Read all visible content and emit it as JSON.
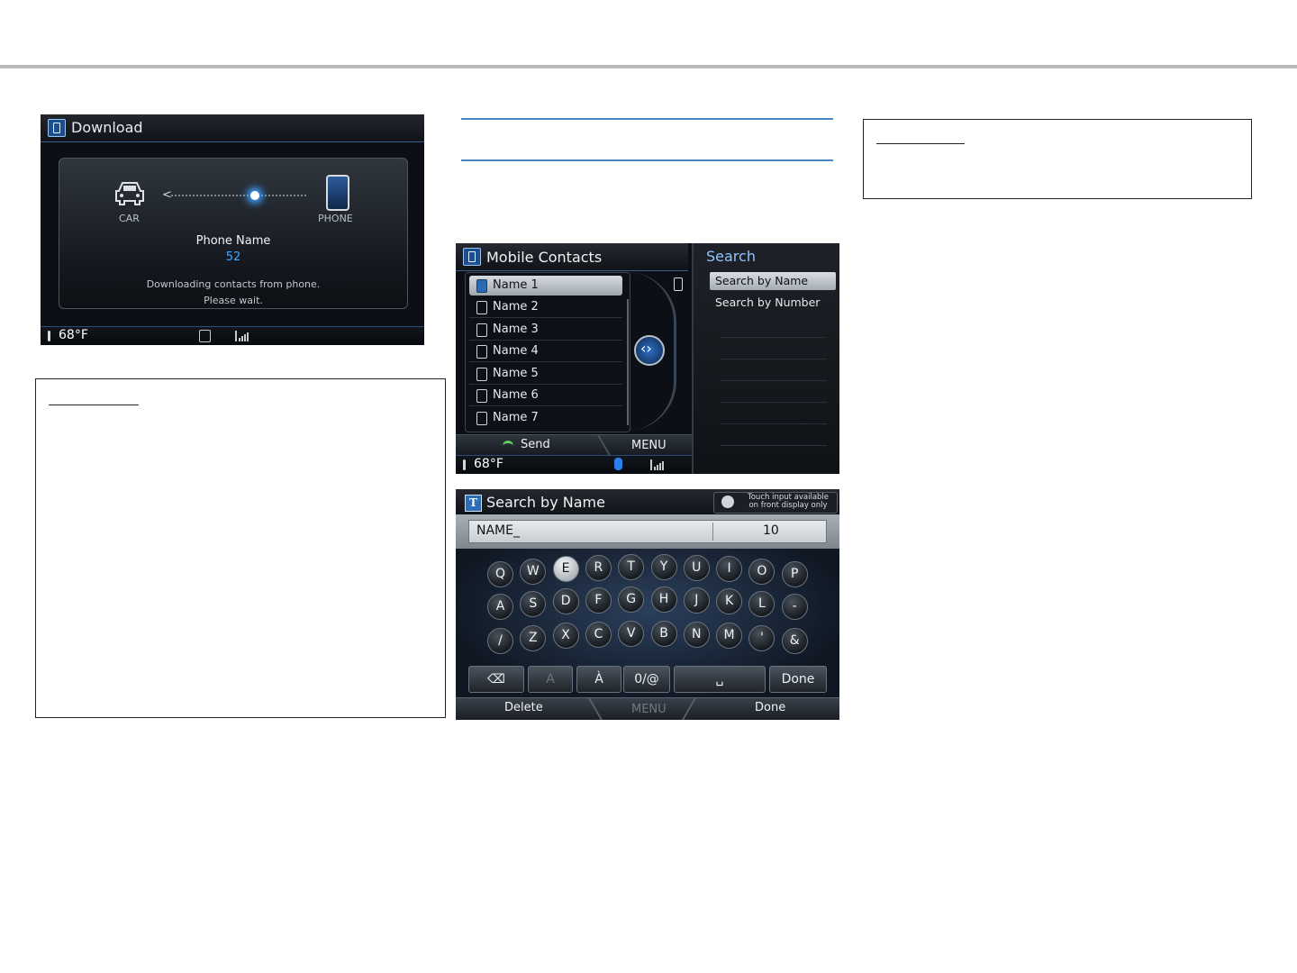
{
  "download_screen": {
    "title": "Download",
    "car_label": "CAR",
    "phone_label": "PHONE",
    "phone_name": "Phone Name",
    "count": "52",
    "message_line1": "Downloading contacts from phone.",
    "message_line2": "Please wait.",
    "temperature": "68°F"
  },
  "contacts_screen": {
    "title": "Mobile Contacts",
    "contacts": [
      "Name 1",
      "Name 2",
      "Name 3",
      "Name 4",
      "Name 5",
      "Name 6",
      "Name 7"
    ],
    "selected_index": 0,
    "search_header": "Search",
    "search_options": [
      "Search by Name",
      "Search by Number"
    ],
    "send_label": "Send",
    "menu_label": "MENU",
    "temperature": "68°F"
  },
  "keyboard_screen": {
    "title": "Search by Name",
    "touch_note_line1": "Touch input available",
    "touch_note_line2": "on front display only",
    "input_value": "NAME_",
    "char_count": "10",
    "rows": [
      [
        "Q",
        "W",
        "E",
        "R",
        "T",
        "Y",
        "U",
        "I",
        "O",
        "P"
      ],
      [
        "A",
        "S",
        "D",
        "F",
        "G",
        "H",
        "J",
        "K",
        "L",
        "-"
      ],
      [
        "/",
        "Z",
        "X",
        "C",
        "V",
        "B",
        "N",
        "M",
        "'",
        "&"
      ]
    ],
    "highlighted_key": "E",
    "function_keys": [
      "⌫",
      "A",
      "À",
      "0/@",
      "␣",
      "Done"
    ],
    "soft_delete": "Delete",
    "soft_menu": "MENU",
    "soft_done": "Done"
  },
  "colors": {
    "accent_blue": "#43a6ff",
    "rule_gray": "#b9b9b9",
    "blue_rule": "#4a86c6"
  }
}
